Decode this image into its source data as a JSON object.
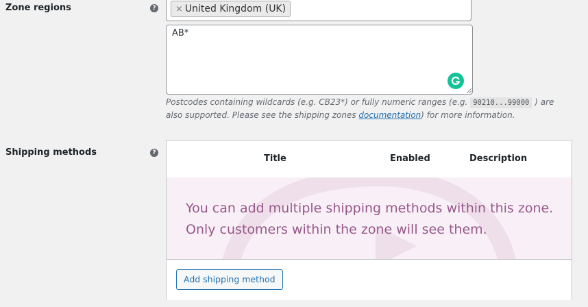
{
  "zone_regions": {
    "label": "Zone regions",
    "help_glyph": "?",
    "selected_regions": [
      {
        "remove_glyph": "×",
        "name": "United Kingdom (UK)"
      }
    ],
    "postcodes_value": "AB*",
    "postcodes_hint": {
      "part1": "Postcodes containing wildcards (e.g. CB23*) or fully numeric ranges (e.g.",
      "code": "90210...99000",
      "part2": ") are also supported. Please see the shipping zones",
      "link": "documentation",
      "part3": ") for more information."
    }
  },
  "shipping_methods": {
    "label": "Shipping methods",
    "help_glyph": "?",
    "columns": [
      "Title",
      "Enabled",
      "Description"
    ],
    "blank_state_line1": "You can add multiple shipping methods within this zone.",
    "blank_state_line2": "Only customers within the zone will see them.",
    "add_button": "Add shipping method"
  },
  "colors": {
    "accent": "#2271b1",
    "brand_purple": "#96588a",
    "grammarly_green": "#15c39a"
  },
  "icons": [
    "help-icon",
    "remove-chip-icon",
    "grammarly-icon",
    "resize-grip-icon",
    "woo-watermark-icon"
  ]
}
